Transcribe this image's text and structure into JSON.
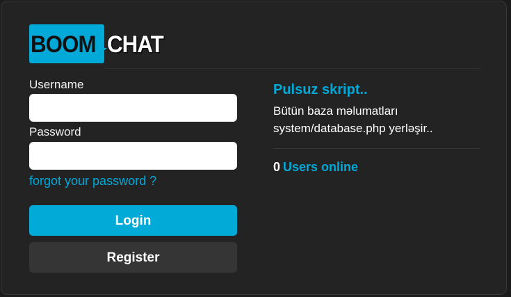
{
  "logo": {
    "part1": "BOOM",
    "part2": "CHAT"
  },
  "login_form": {
    "username_label": "Username",
    "username_value": "",
    "password_label": "Password",
    "password_value": "",
    "forgot_link": "forgot your password ?",
    "login_button": "Login",
    "register_button": "Register"
  },
  "info": {
    "title": "Pulsuz skript..",
    "line1": "Bütün baza məlumatları",
    "line2": "system/database.php yerləşir.."
  },
  "online": {
    "count": "0",
    "label": "Users online"
  },
  "colors": {
    "accent": "#01a9d8",
    "background": "#232323",
    "register_button": "#353535"
  }
}
